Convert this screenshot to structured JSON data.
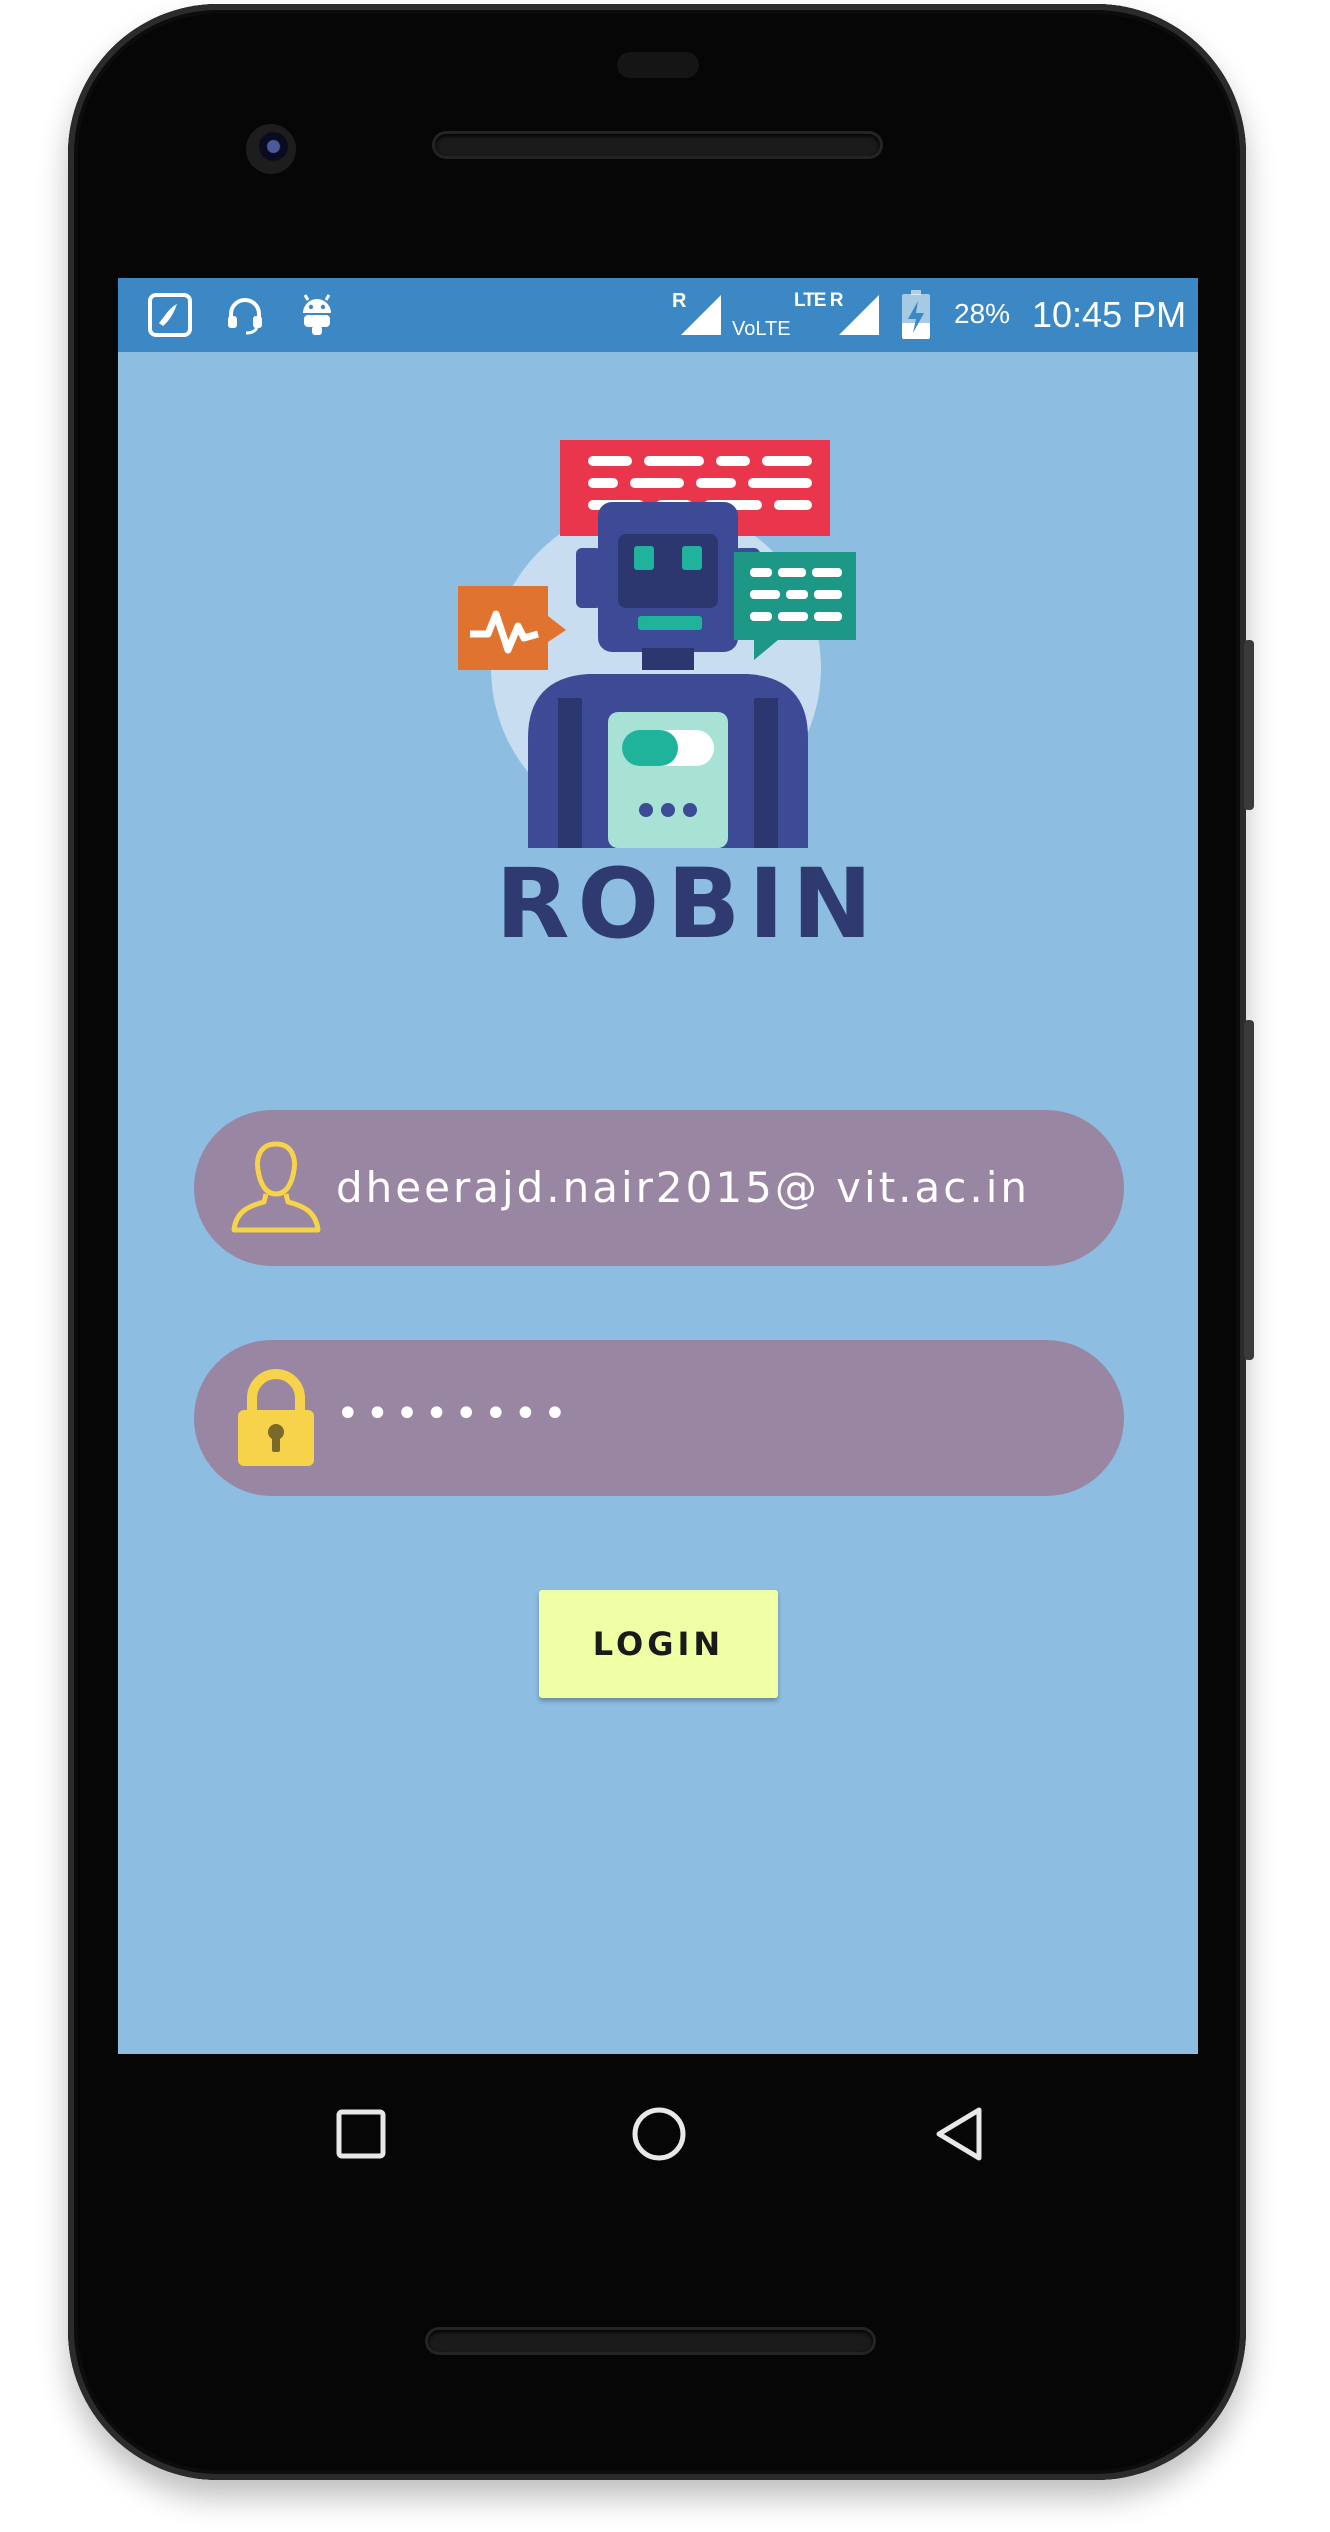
{
  "status_bar": {
    "notification_icons": [
      "saavn-icon",
      "headset-icon",
      "android-icon"
    ],
    "sim1_roaming": "R",
    "volte": "VoLTE",
    "lte_roaming": "LTE R",
    "battery_percent": "28%",
    "time": "10:45 PM"
  },
  "app": {
    "title": "ROBIN",
    "email_value": "dheerajd.nair2015@ vit.ac.in",
    "password_value": "••••••••",
    "login_label": "LOGIN"
  },
  "colors": {
    "screen_bg": "#8dbde0",
    "status_bar_bg": "#3b88c4",
    "title": "#2f3a70",
    "field_bg": "#9886a2",
    "login_bg": "#eeffa4",
    "icon_yellow": "#f6d34a"
  },
  "nav_bar": {
    "buttons": [
      "recents-icon",
      "home-icon",
      "back-icon"
    ]
  }
}
